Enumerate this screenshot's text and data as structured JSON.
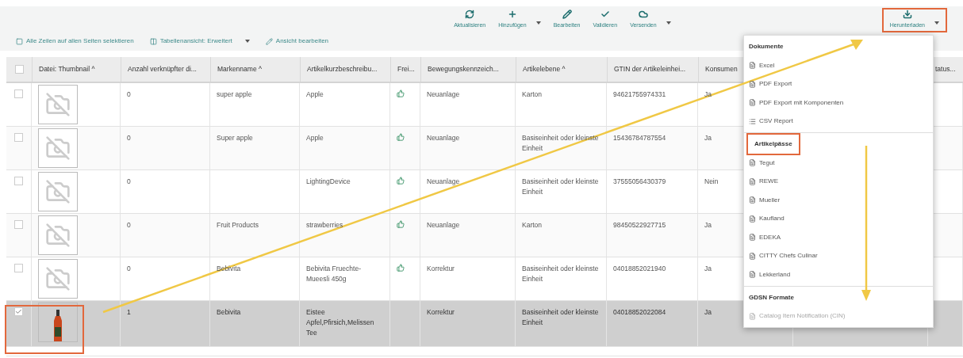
{
  "toolbar": {
    "actions": [
      {
        "label": "Aktualisieren",
        "kind": "refresh",
        "dropdown": false,
        "highlighted": false
      },
      {
        "label": "Hinzufügen",
        "kind": "add",
        "dropdown": true,
        "highlighted": false
      },
      {
        "label": "Bearbeiten",
        "kind": "edit",
        "dropdown": false,
        "highlighted": false
      },
      {
        "label": "Validieren",
        "kind": "validate",
        "dropdown": false,
        "highlighted": false
      },
      {
        "label": "Versenden",
        "kind": "send",
        "dropdown": true,
        "highlighted": false
      },
      {
        "label": "Herunterladen",
        "kind": "download",
        "dropdown": true,
        "highlighted": true
      }
    ]
  },
  "view_bar": [
    {
      "label": "Alle Zeilen auf allen Seiten selektieren",
      "kind": "select-all",
      "dropdown": false
    },
    {
      "label": "Tabellenansicht: Erweitert",
      "kind": "table-view",
      "dropdown": true
    },
    {
      "label": "Ansicht bearbeiten",
      "kind": "edit-view",
      "dropdown": false
    }
  ],
  "table": {
    "all_selected": false,
    "columns": [
      {
        "label": "Datei: Thumbnail ^"
      },
      {
        "label": "Anzahl verknüpfter di..."
      },
      {
        "label": "Markenname ^"
      },
      {
        "label": "Artikelkurzbeschreibu..."
      },
      {
        "label": "Frei..."
      },
      {
        "label": "Bewegungskennzeich..."
      },
      {
        "label": "Artikelebene ^"
      },
      {
        "label": "GTIN der Artikeleinhei..."
      },
      {
        "label": "Konsumen"
      },
      {
        "label": "tatus..."
      }
    ],
    "rows": [
      {
        "selected": false,
        "has_photo": false,
        "released": true,
        "cells": [
          null,
          "0",
          "super apple",
          "Apple",
          null,
          "Neuanlage",
          "Karton",
          "94621755974331",
          "Ja"
        ]
      },
      {
        "selected": false,
        "has_photo": false,
        "released": true,
        "cells": [
          null,
          "0",
          "Super apple",
          "Apple",
          null,
          "Neuanlage",
          "Basiseinheit oder kleinste Einheit",
          "15436784787554",
          "Ja"
        ]
      },
      {
        "selected": false,
        "has_photo": false,
        "released": true,
        "cells": [
          null,
          "0",
          null,
          "LightingDevice",
          null,
          "Neuanlage",
          "Basiseinheit oder kleinste Einheit",
          "37555056430379",
          "Nein"
        ]
      },
      {
        "selected": false,
        "has_photo": false,
        "released": true,
        "cells": [
          null,
          "0",
          "Fruit Products",
          "strawberries",
          null,
          "Neuanlage",
          "Karton",
          "98450522927715",
          "Ja"
        ]
      },
      {
        "selected": false,
        "has_photo": false,
        "released": true,
        "cells": [
          null,
          "0",
          "Bebivita",
          "Bebivita Fruechte-Mueesli 450g",
          null,
          "Korrektur",
          "Basiseinheit oder kleinste Einheit",
          "04018852021940",
          "Ja"
        ]
      },
      {
        "selected": true,
        "has_photo": true,
        "released": false,
        "cells": [
          null,
          "1",
          "Bebivita",
          "Eistee Apfel,Pfirsich,Melissen Tee",
          null,
          "Korrektur",
          "Basiseinheit oder kleinste Einheit",
          "04018852022084",
          "Ja"
        ]
      }
    ]
  },
  "download_menu": {
    "sections": [
      {
        "title": "Dokumente",
        "highlighted": false,
        "items": [
          {
            "label": "Excel",
            "kind": "file",
            "disabled": false
          },
          {
            "label": "PDF Export",
            "kind": "file",
            "disabled": false
          },
          {
            "label": "PDF Export mit Komponenten",
            "kind": "file",
            "disabled": false
          },
          {
            "label": "CSV Report",
            "kind": "list",
            "disabled": false
          }
        ]
      },
      {
        "title": "Artikelpässe",
        "highlighted": true,
        "items": [
          {
            "label": "Tegut",
            "kind": "file",
            "disabled": false
          },
          {
            "label": "REWE",
            "kind": "file",
            "disabled": false
          },
          {
            "label": "Mueller",
            "kind": "file",
            "disabled": false
          },
          {
            "label": "Kaufland",
            "kind": "file",
            "disabled": false
          },
          {
            "label": "EDEKA",
            "kind": "file",
            "disabled": false
          },
          {
            "label": "CITTY Chefs Culinar",
            "kind": "file",
            "disabled": false
          },
          {
            "label": "Lekkerland",
            "kind": "file",
            "disabled": false
          }
        ]
      },
      {
        "title": "GDSN Formate",
        "highlighted": false,
        "items": [
          {
            "label": "Catalog Item Notification (CIN)",
            "kind": "file",
            "disabled": true
          }
        ]
      }
    ]
  }
}
